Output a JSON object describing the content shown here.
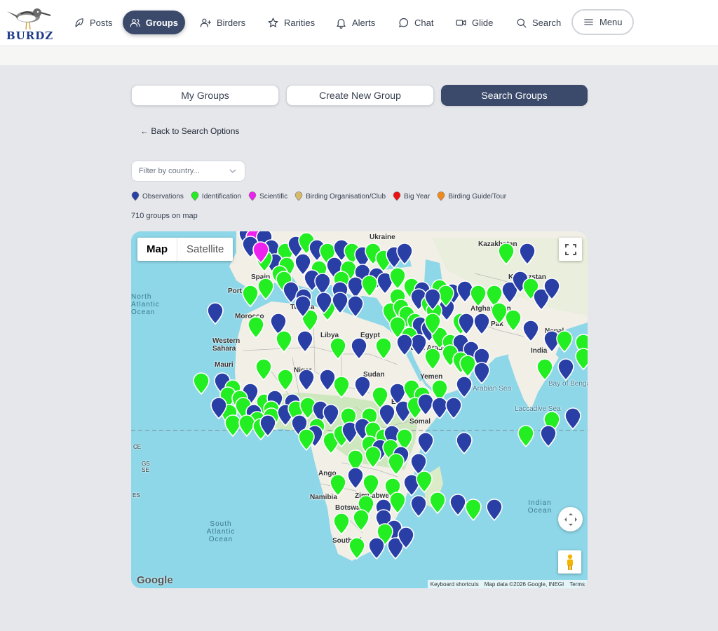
{
  "brand": {
    "logo_text": "BURDZ"
  },
  "nav": {
    "items": [
      {
        "label": "Posts",
        "icon": "feather-icon"
      },
      {
        "label": "Groups",
        "icon": "users-icon",
        "active": true
      },
      {
        "label": "Birders",
        "icon": "user-plus-icon"
      },
      {
        "label": "Rarities",
        "icon": "star-icon"
      },
      {
        "label": "Alerts",
        "icon": "bell-icon"
      },
      {
        "label": "Chat",
        "icon": "chat-icon"
      },
      {
        "label": "Glide",
        "icon": "video-icon"
      },
      {
        "label": "Search",
        "icon": "search-icon"
      }
    ],
    "menu_label": "Menu"
  },
  "tabs": [
    {
      "label": "My Groups",
      "active": false
    },
    {
      "label": "Create New Group",
      "active": false
    },
    {
      "label": "Search Groups",
      "active": true
    }
  ],
  "back_link": "← Back to Search Options",
  "filter": {
    "placeholder": "Filter by country..."
  },
  "legend": [
    {
      "label": "Observations",
      "color": "#2a3fa6"
    },
    {
      "label": "Identification",
      "color": "#22ee22"
    },
    {
      "label": "Scientific",
      "color": "#ee22ee"
    },
    {
      "label": "Birding Organisation/Club",
      "color": "#d9b86a"
    },
    {
      "label": "Big Year",
      "color": "#ee1111"
    },
    {
      "label": "Birding Guide/Tour",
      "color": "#f08a1c"
    }
  ],
  "group_count": "710 groups on map",
  "map": {
    "type_buttons": {
      "map": "Map",
      "satellite": "Satellite"
    },
    "country_labels": [
      "Kazakhstan",
      "Kyrgyzstan",
      "Ukraine",
      "Spain",
      "Port",
      "Tunisia",
      "Morocco",
      "Afghanistan",
      "Pak",
      "Nepal",
      "India",
      "Libya",
      "Egypt",
      "Western Sahara",
      "Mauri",
      "Niger",
      "Sudan",
      "Saudi Arabia",
      "Yemen",
      "Arabian Sea",
      "Bay of Bengal",
      "Laccadive Sea",
      "Ango",
      "Namibia",
      "Zimbabwe",
      "Botswana",
      "South Af",
      "Somal",
      "Eth",
      "CE",
      "GS",
      "SE",
      "ES"
    ],
    "ocean_labels": [
      "North Atlantic Ocean",
      "South Atlantic Ocean",
      "Indian Ocean"
    ],
    "google_logo": "Google",
    "attribution": {
      "shortcuts": "Keyboard shortcuts",
      "data": "Map data ©2026 Google, INEGI",
      "terms": "Terms"
    }
  }
}
